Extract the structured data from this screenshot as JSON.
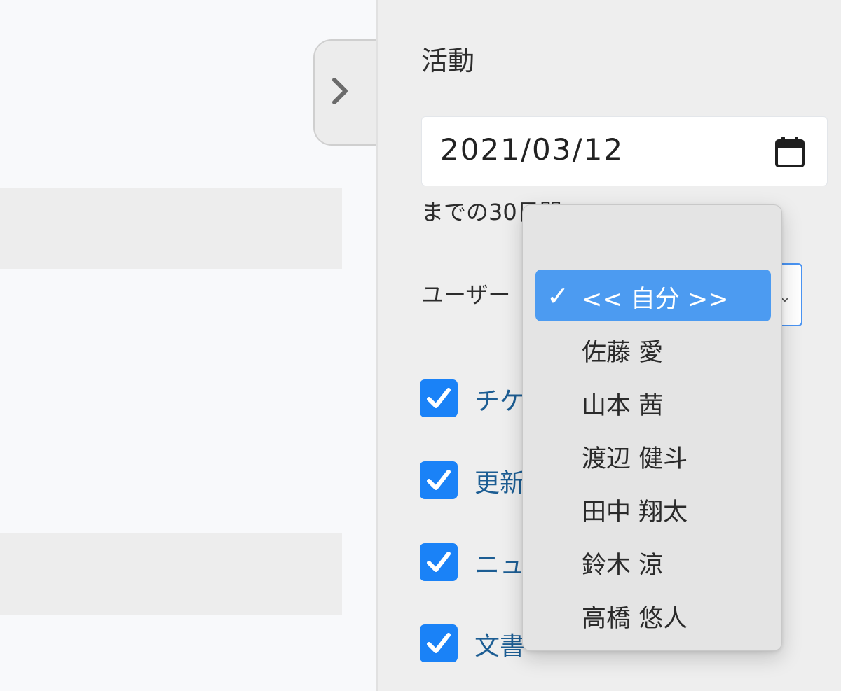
{
  "panel": {
    "title": "活動",
    "date_value": "2021/03/12",
    "range_text": "までの30日間",
    "user_label": "ユーザー"
  },
  "filters": [
    {
      "label": "チケット",
      "checked": true
    },
    {
      "label": "更新",
      "checked": true
    },
    {
      "label": "ニュース",
      "checked": true
    },
    {
      "label": "文書",
      "checked": true
    }
  ],
  "user_dropdown": {
    "selected": "<< 自分 >>",
    "options": [
      {
        "label": "<< 自分 >>",
        "selected": true
      },
      {
        "label": "佐藤 愛",
        "selected": false
      },
      {
        "label": "山本 茜",
        "selected": false
      },
      {
        "label": "渡辺 健斗",
        "selected": false
      },
      {
        "label": "田中 翔太",
        "selected": false
      },
      {
        "label": "鈴木 涼",
        "selected": false
      },
      {
        "label": "高橋 悠人",
        "selected": false
      }
    ]
  },
  "colors": {
    "accent": "#1a82f7",
    "selection": "#4c9bf1",
    "link": "#1c5d93"
  }
}
